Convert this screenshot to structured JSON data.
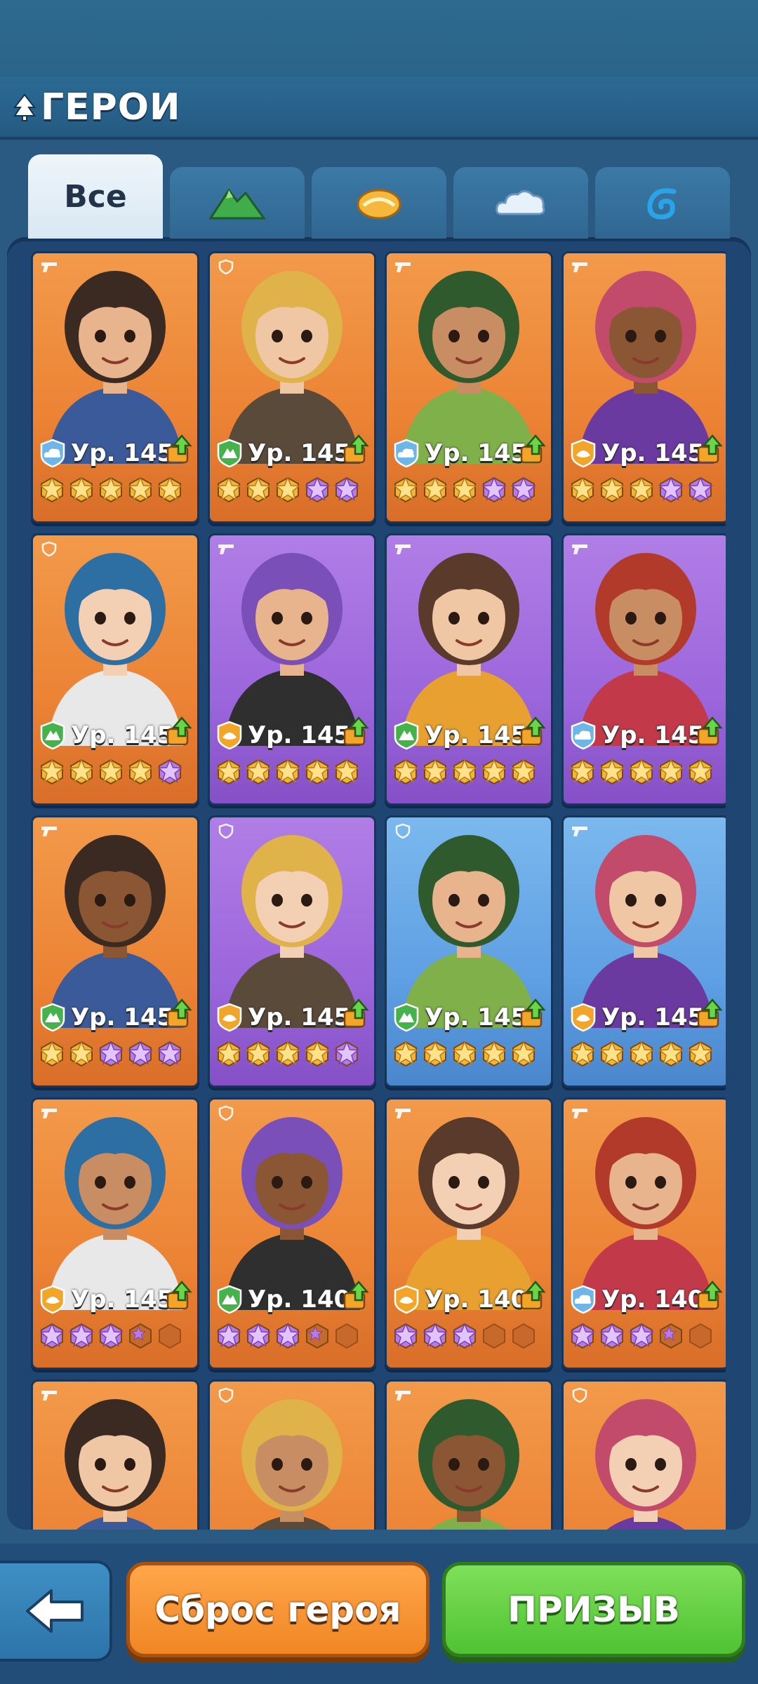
{
  "header": {
    "title": "ГЕРОИ"
  },
  "tabs": [
    {
      "label": "Все",
      "icon": "all",
      "active": true
    },
    {
      "label": "",
      "icon": "mountain-element-icon"
    },
    {
      "label": "",
      "icon": "sun-element-icon"
    },
    {
      "label": "",
      "icon": "cloud-element-icon"
    },
    {
      "label": "",
      "icon": "wave-element-icon"
    }
  ],
  "heroes": [
    {
      "bg": "orange",
      "role": "gun",
      "element": "cloud",
      "level": "Ур. 145",
      "stars": [
        "gold",
        "gold",
        "gold",
        "gold",
        "gold"
      ]
    },
    {
      "bg": "orange",
      "role": "shield",
      "element": "mountain",
      "level": "Ур. 145",
      "stars": [
        "gold",
        "gold",
        "gold",
        "purple",
        "purple"
      ]
    },
    {
      "bg": "orange",
      "role": "gun",
      "element": "cloud",
      "level": "Ур. 145",
      "stars": [
        "gold",
        "gold",
        "gold",
        "purple",
        "purple"
      ]
    },
    {
      "bg": "orange",
      "role": "gun",
      "element": "sun",
      "level": "Ур. 145",
      "stars": [
        "gold",
        "gold",
        "gold",
        "purple",
        "purple"
      ]
    },
    {
      "bg": "orange",
      "role": "shield",
      "element": "mountain",
      "level": "Ур. 145",
      "stars": [
        "gold",
        "gold",
        "gold",
        "gold",
        "purple"
      ]
    },
    {
      "bg": "purple",
      "role": "gun",
      "element": "sun",
      "level": "Ур. 145",
      "stars": [
        "gold",
        "gold",
        "gold",
        "gold",
        "gold"
      ]
    },
    {
      "bg": "purple",
      "role": "gun",
      "element": "mountain",
      "level": "Ур. 145",
      "stars": [
        "gold",
        "gold",
        "gold",
        "gold",
        "gold"
      ]
    },
    {
      "bg": "purple",
      "role": "gun",
      "element": "cloud",
      "level": "Ур. 145",
      "stars": [
        "gold",
        "gold",
        "gold",
        "gold",
        "gold"
      ]
    },
    {
      "bg": "orange",
      "role": "gun",
      "element": "mountain",
      "level": "Ур. 145",
      "stars": [
        "gold",
        "gold",
        "purple",
        "purple",
        "purple"
      ]
    },
    {
      "bg": "purple",
      "role": "shield",
      "element": "sun",
      "level": "Ур. 145",
      "stars": [
        "gold",
        "gold",
        "gold",
        "gold",
        "purple"
      ]
    },
    {
      "bg": "blue",
      "role": "shield",
      "element": "mountain",
      "level": "Ур. 145",
      "stars": [
        "gold",
        "gold",
        "gold",
        "gold",
        "gold"
      ]
    },
    {
      "bg": "blue",
      "role": "gun",
      "element": "sun",
      "level": "Ур. 145",
      "stars": [
        "gold",
        "gold",
        "gold",
        "gold",
        "gold"
      ]
    },
    {
      "bg": "orange",
      "role": "gun",
      "element": "sun",
      "level": "Ур. 145",
      "stars": [
        "purple",
        "purple",
        "purple",
        "half",
        "empty"
      ]
    },
    {
      "bg": "orange",
      "role": "shield",
      "element": "mountain",
      "level": "Ур. 140",
      "stars": [
        "purple",
        "purple",
        "purple",
        "half",
        "empty"
      ]
    },
    {
      "bg": "orange",
      "role": "gun",
      "element": "sun",
      "level": "Ур. 140",
      "stars": [
        "purple",
        "purple",
        "purple",
        "empty",
        "empty"
      ]
    },
    {
      "bg": "orange",
      "role": "gun",
      "element": "cloud",
      "level": "Ур. 140",
      "stars": [
        "purple",
        "purple",
        "purple",
        "half",
        "empty"
      ]
    },
    {
      "bg": "orange",
      "role": "gun",
      "element": "",
      "level": "",
      "stars": []
    },
    {
      "bg": "orange",
      "role": "shield",
      "element": "",
      "level": "",
      "stars": []
    },
    {
      "bg": "orange",
      "role": "gun",
      "element": "",
      "level": "",
      "stars": []
    },
    {
      "bg": "orange",
      "role": "shield",
      "element": "",
      "level": "",
      "stars": []
    }
  ],
  "footer": {
    "reset_label": "Сброс героя",
    "summon_label": "ПРИЗЫВ"
  },
  "colors": {
    "card_orange": "#ec8335",
    "card_purple": "#9c66dc",
    "card_blue": "#5f9fe3",
    "star_gold": "#f2b53a",
    "star_purple": "#b57be8",
    "button_orange": "#f08624",
    "button_green": "#4fc233"
  }
}
